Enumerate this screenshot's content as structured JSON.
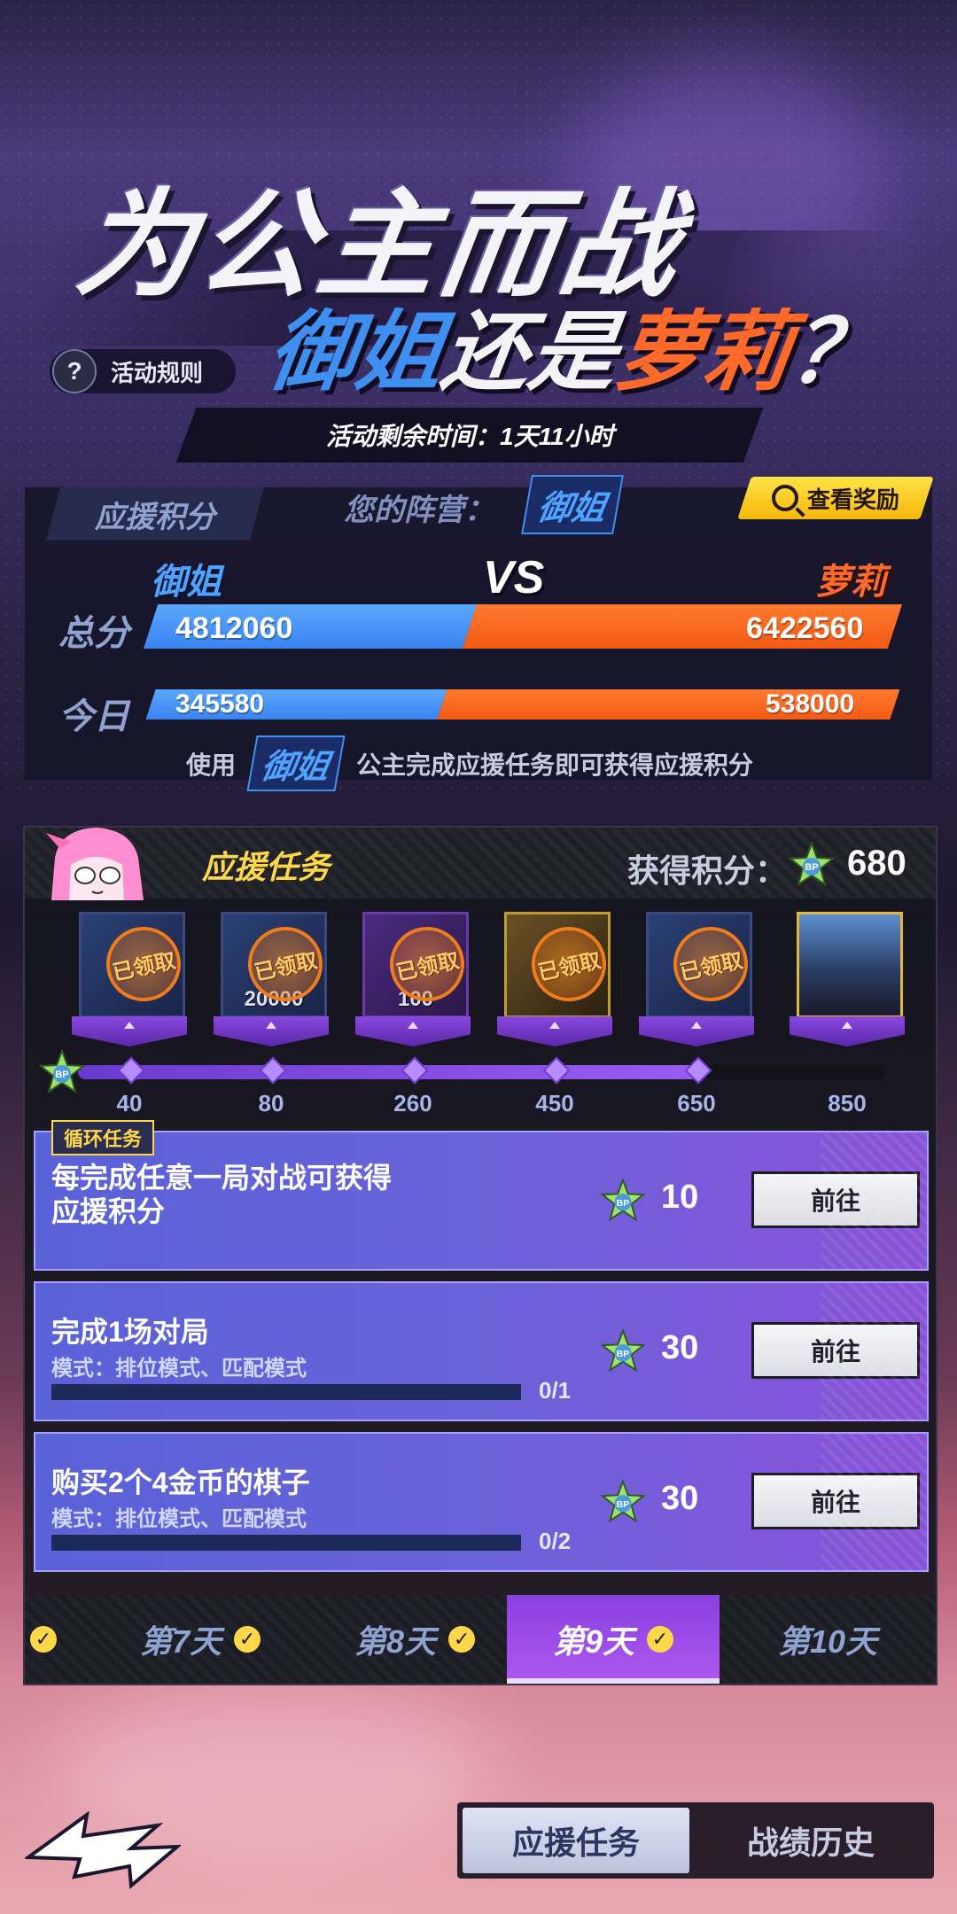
{
  "event": {
    "title": "为公主而战",
    "subtitle_part1": "御姐",
    "subtitle_part2": "还是",
    "subtitle_part3": "萝莉",
    "subtitle_part4": "？",
    "rules_label": "活动规则",
    "rules_icon": "?",
    "time_remaining": "活动剩余时间：1天11小时"
  },
  "score": {
    "tab_label": "应援积分",
    "your_camp_label": "您的阵营：",
    "your_camp": "御姐",
    "view_rewards_label": "查看奖励",
    "side_a": "御姐",
    "side_b": "萝莉",
    "vs": "VS",
    "total_label": "总分",
    "total_a": "4812060",
    "total_b": "6422560",
    "today_label": "今日",
    "today_a": "345580",
    "today_b": "538000",
    "hint_prefix": "使用",
    "hint_camp": "御姐",
    "hint_suffix": "公主完成应援任务即可获得应援积分"
  },
  "tasks": {
    "title": "应援任务",
    "earned_label": "获得积分：",
    "earned_value": "680",
    "claimed_stamp": "已领取",
    "milestones": [
      {
        "label": "40",
        "qty": "",
        "claimed": true
      },
      {
        "label": "80",
        "qty": "20000",
        "claimed": true
      },
      {
        "label": "260",
        "qty": "100",
        "claimed": true
      },
      {
        "label": "450",
        "qty": "",
        "claimed": true
      },
      {
        "label": "650",
        "qty": "",
        "claimed": true
      },
      {
        "label": "850",
        "qty": "",
        "claimed": false
      }
    ],
    "progress_fraction": 0.77,
    "cyclic_tag": "循环任务",
    "go_label": "前往",
    "items": [
      {
        "name": "每完成任意一局对战可获得\n应援积分",
        "points": "10",
        "mode": "",
        "progress": "",
        "progress_fraction": 0
      },
      {
        "name": "完成1场对局",
        "points": "30",
        "mode": "模式：排位模式、匹配模式",
        "progress": "0/1",
        "progress_fraction": 0
      },
      {
        "name": "购买2个4金币的棋子",
        "points": "30",
        "mode": "模式：排位模式、匹配模式",
        "progress": "0/2",
        "progress_fraction": 0
      }
    ],
    "days": [
      {
        "label": "第7天",
        "done": true
      },
      {
        "label": "第8天",
        "done": true
      },
      {
        "label": "第9天",
        "done": true,
        "selected": true
      },
      {
        "label": "第10天",
        "done": false
      }
    ]
  },
  "bottom": {
    "tab_tasks": "应援任务",
    "tab_history": "战绩历史"
  },
  "colors": {
    "camp_a": "#3f8ff0",
    "camp_b": "#ff6a2a",
    "accent": "#ffd84a",
    "selected_day": "#9b4ee8"
  },
  "icons": [
    "question-icon",
    "search-icon",
    "bp-star-icon",
    "check-icon",
    "back-arrow-icon"
  ]
}
